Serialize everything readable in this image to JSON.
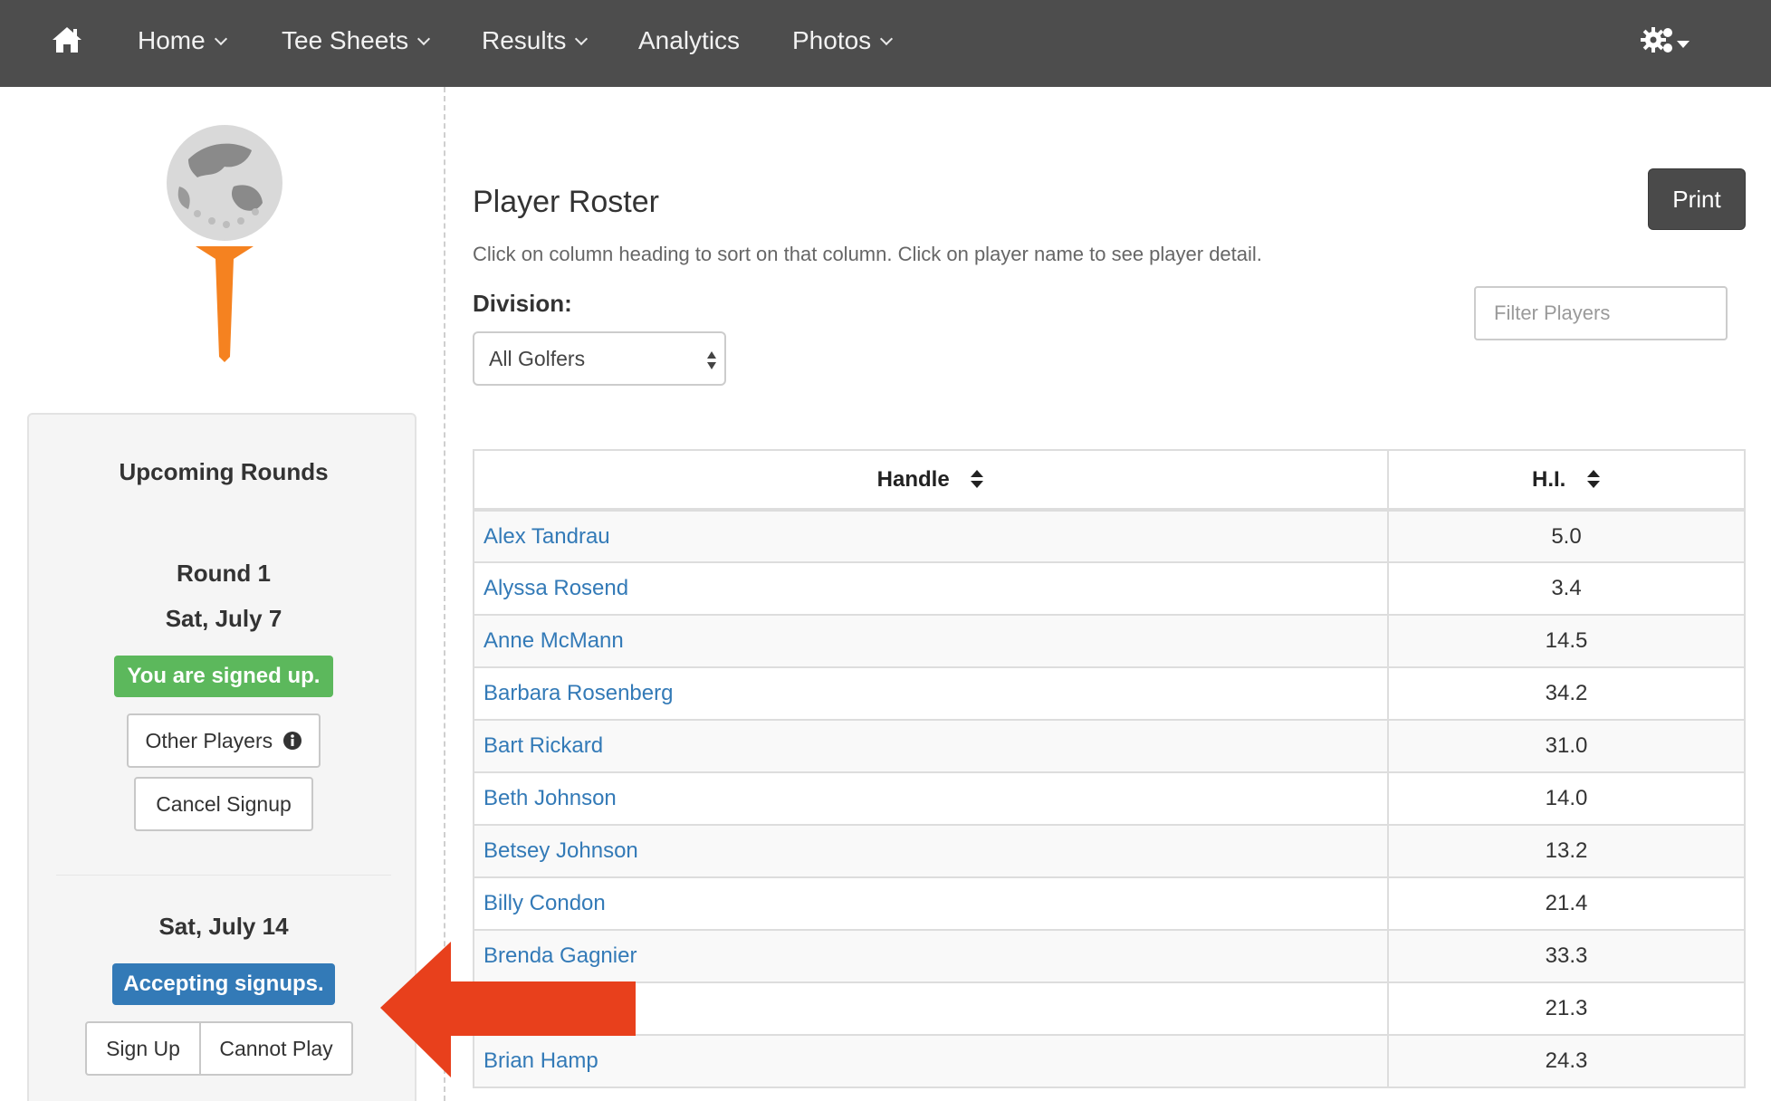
{
  "nav": {
    "items": [
      {
        "label": "Home",
        "has_dropdown": true
      },
      {
        "label": "Tee Sheets",
        "has_dropdown": true
      },
      {
        "label": "Results",
        "has_dropdown": true
      },
      {
        "label": "Analytics",
        "has_dropdown": false
      },
      {
        "label": "Photos",
        "has_dropdown": true
      }
    ],
    "background": "#4d4d4d"
  },
  "sidebar": {
    "title": "Upcoming Rounds",
    "rounds": [
      {
        "name": "Round 1",
        "date": "Sat, July 7",
        "status": "You are signed up.",
        "status_color": "#5cb85c",
        "buttons": [
          "Other Players",
          "Cancel Signup"
        ]
      },
      {
        "name": "",
        "date": "Sat, July 14",
        "status": "Accepting signups.",
        "status_color": "#337ab7",
        "buttons": [
          "Sign Up",
          "Cannot Play"
        ]
      }
    ]
  },
  "main": {
    "title": "Player Roster",
    "instructions": "Click on column heading to sort on that column. Click on player name to see player detail.",
    "division_label": "Division:",
    "division_selected": "All Golfers",
    "print_label": "Print",
    "filter_placeholder": "Filter Players"
  },
  "table": {
    "columns": [
      "Handle",
      "H.I."
    ],
    "rows": [
      {
        "handle": "Alex Tandrau",
        "hi": "5.0"
      },
      {
        "handle": "Alyssa Rosend",
        "hi": "3.4"
      },
      {
        "handle": "Anne McMann",
        "hi": "14.5"
      },
      {
        "handle": "Barbara Rosenberg",
        "hi": "34.2"
      },
      {
        "handle": "Bart Rickard",
        "hi": "31.0"
      },
      {
        "handle": "Beth Johnson",
        "hi": "14.0"
      },
      {
        "handle": "Betsey Johnson",
        "hi": "13.2"
      },
      {
        "handle": "Billy Condon",
        "hi": "21.4"
      },
      {
        "handle": "Brenda Gagnier",
        "hi": "33.3"
      },
      {
        "handle": "",
        "hi": "21.3"
      },
      {
        "handle": "Brian Hamp",
        "hi": "24.3"
      }
    ]
  },
  "colors": {
    "link": "#337ab7",
    "arrow": "#e8401c",
    "logo_tee": "#f58220"
  },
  "icons": [
    "home-icon",
    "chevron-down-icon",
    "gears-icon",
    "caret-down-icon",
    "info-circle-icon",
    "sort-icon",
    "select-arrows-icon",
    "red-arrow-annotation"
  ]
}
